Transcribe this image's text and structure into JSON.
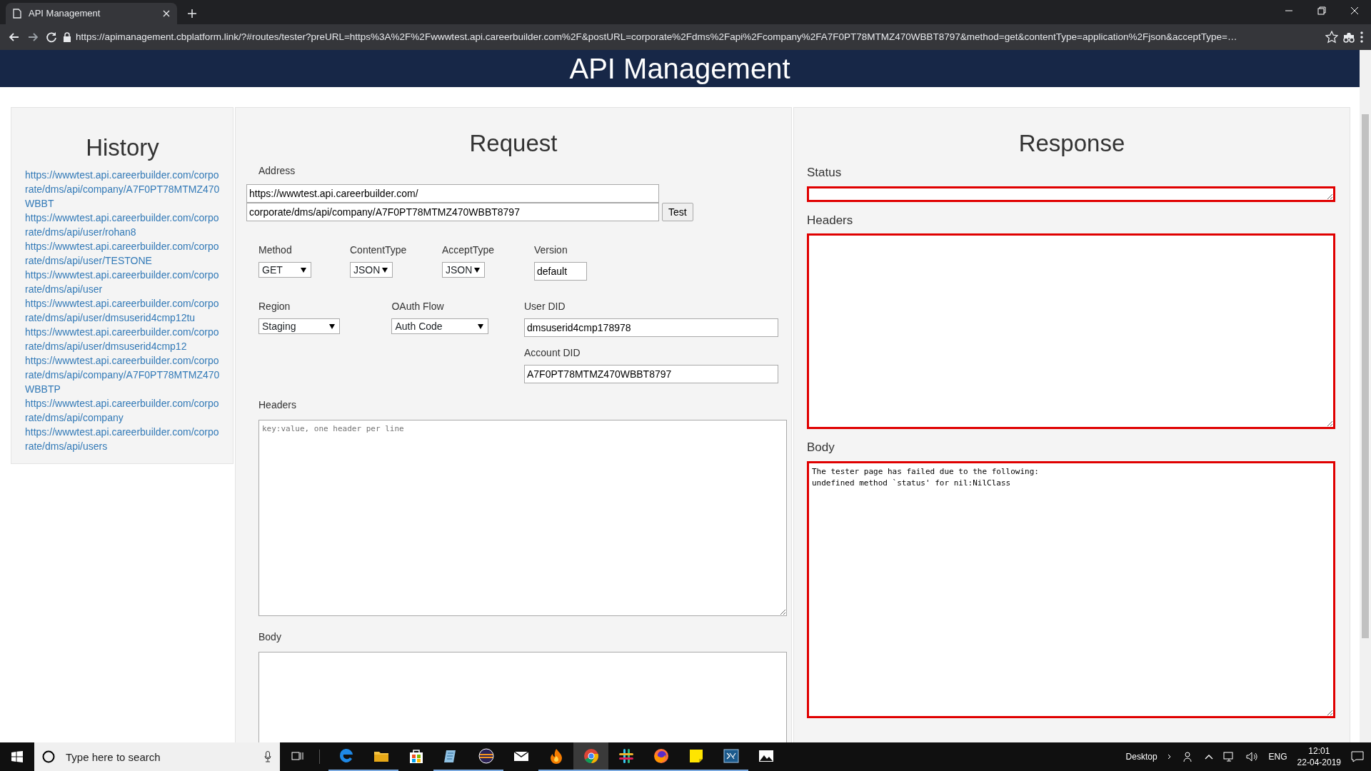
{
  "browser": {
    "tab_title": "API Management",
    "url": "https://apimanagement.cbplatform.link/?#routes/tester?preURL=https%3A%2F%2Fwwwtest.api.careerbuilder.com%2F&postURL=corporate%2Fdms%2Fapi%2Fcompany%2FA7F0PT78MTMZ470WBBT8797&method=get&contentType=application%2Fjson&acceptType=…"
  },
  "page": {
    "title": "API Management"
  },
  "history": {
    "title": "History",
    "items": [
      "https://wwwtest.api.careerbuilder.com/corporate/dms/api/company/A7F0PT78MTMZ470WBBT",
      "https://wwwtest.api.careerbuilder.com/corporate/dms/api/user/rohan8",
      "https://wwwtest.api.careerbuilder.com/corporate/dms/api/user/TESTONE",
      "https://wwwtest.api.careerbuilder.com/corporate/dms/api/user",
      "https://wwwtest.api.careerbuilder.com/corporate/dms/api/user/dmsuserid4cmp12tu",
      "https://wwwtest.api.careerbuilder.com/corporate/dms/api/user/dmsuserid4cmp12",
      "https://wwwtest.api.careerbuilder.com/corporate/dms/api/company/A7F0PT78MTMZ470WBBTP",
      "https://wwwtest.api.careerbuilder.com/corporate/dms/api/company",
      "https://wwwtest.api.careerbuilder.com/corporate/dms/api/users"
    ]
  },
  "request": {
    "title": "Request",
    "address_label": "Address",
    "address_base": "https://wwwtest.api.careerbuilder.com/",
    "address_path": "corporate/dms/api/company/A7F0PT78MTMZ470WBBT8797",
    "test_button": "Test",
    "method": {
      "label": "Method",
      "value": "GET"
    },
    "content_type": {
      "label": "ContentType",
      "value": "JSON"
    },
    "accept_type": {
      "label": "AcceptType",
      "value": "JSON"
    },
    "version": {
      "label": "Version",
      "value": "default"
    },
    "region": {
      "label": "Region",
      "value": "Staging"
    },
    "oauth_flow": {
      "label": "OAuth Flow",
      "value": "Auth Code"
    },
    "user_did": {
      "label": "User DID",
      "value": "dmsuserid4cmp178978"
    },
    "account_did": {
      "label": "Account DID",
      "value": "A7F0PT78MTMZ470WBBT8797"
    },
    "headers": {
      "label": "Headers",
      "placeholder": "key:value, one header per line"
    },
    "body": {
      "label": "Body"
    }
  },
  "response": {
    "title": "Response",
    "status": {
      "label": "Status",
      "invalid": true
    },
    "headers": {
      "label": "Headers",
      "invalid": true
    },
    "body": {
      "label": "Body",
      "invalid": true,
      "lines": [
        "The tester page has failed due to the following:",
        "undefined method `status' for nil:NilClass"
      ]
    }
  },
  "taskbar": {
    "search_placeholder": "Type here to search",
    "apps": [
      {
        "kind": "edge",
        "running": true,
        "selected": false
      },
      {
        "kind": "folder",
        "running": true,
        "selected": false
      },
      {
        "kind": "store",
        "running": false,
        "selected": false
      },
      {
        "kind": "notepad",
        "running": true,
        "selected": false
      },
      {
        "kind": "disc",
        "running": true,
        "selected": false
      },
      {
        "kind": "mail",
        "running": false,
        "selected": false
      },
      {
        "kind": "flame",
        "running": true,
        "selected": false
      },
      {
        "kind": "chrome",
        "running": true,
        "selected": true
      },
      {
        "kind": "grid",
        "running": true,
        "selected": false
      },
      {
        "kind": "firefox",
        "running": true,
        "selected": false
      },
      {
        "kind": "sticky",
        "running": true,
        "selected": false
      },
      {
        "kind": "terminal",
        "running": true,
        "selected": false
      },
      {
        "kind": "photo",
        "running": false,
        "selected": false
      }
    ],
    "desktop_label": "Desktop",
    "language": "ENG",
    "time": "12:01",
    "date": "22-04-2019"
  }
}
